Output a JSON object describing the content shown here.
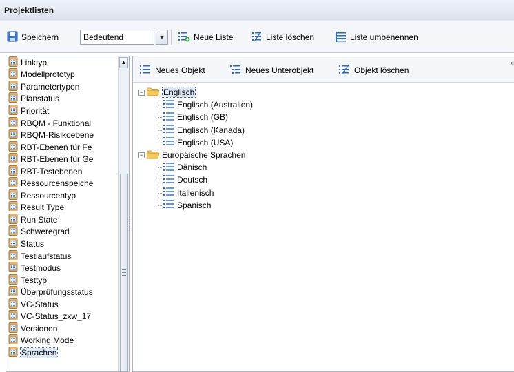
{
  "window": {
    "title": "Projektlisten"
  },
  "toolbar": {
    "save_label": "Speichern",
    "filter_value": "Bedeutend",
    "new_list_label": "Neue Liste",
    "delete_list_label": "Liste löschen",
    "rename_list_label": "Liste umbenennen"
  },
  "lists": {
    "items": [
      {
        "label": "Linktyp"
      },
      {
        "label": "Modellprototyp"
      },
      {
        "label": "Parametertypen"
      },
      {
        "label": "Planstatus"
      },
      {
        "label": "Priorität"
      },
      {
        "label": "RBQM - Funktional"
      },
      {
        "label": "RBQM-Risikoebene"
      },
      {
        "label": "RBT-Ebenen für Fe"
      },
      {
        "label": "RBT-Ebenen für Ge"
      },
      {
        "label": "RBT-Testebenen"
      },
      {
        "label": "Ressourcenspeiche"
      },
      {
        "label": "Ressourcentyp"
      },
      {
        "label": "Result Type"
      },
      {
        "label": "Run State"
      },
      {
        "label": "Schweregrad"
      },
      {
        "label": "Status"
      },
      {
        "label": "Testlaufstatus"
      },
      {
        "label": "Testmodus"
      },
      {
        "label": "Testtyp"
      },
      {
        "label": "Überprüfungsstatus"
      },
      {
        "label": "VC-Status"
      },
      {
        "label": "VC-Status_zxw_17"
      },
      {
        "label": "Versionen"
      },
      {
        "label": "Working Mode"
      },
      {
        "label": "Sprachen"
      }
    ],
    "selected": "Sprachen"
  },
  "objects_toolbar": {
    "new_object_label": "Neues Objekt",
    "new_subobject_label": "Neues Unterobjekt",
    "delete_object_label": "Objekt löschen"
  },
  "tree": {
    "groups": [
      {
        "label": "Englisch",
        "children": [
          "Englisch (Australien)",
          "Englisch (GB)",
          "Englisch (Kanada)",
          "Englisch (USA)"
        ]
      },
      {
        "label": "Europäische Sprachen",
        "children": [
          "Dänisch",
          "Deutsch",
          "Italienisch",
          "Spanisch"
        ]
      }
    ]
  },
  "icons": {
    "save": "save-icon",
    "dropdown": "chevron-down-icon",
    "new_list": "new-list-icon",
    "delete_list": "delete-list-icon",
    "rename_list": "rename-list-icon",
    "list_item": "list-table-icon",
    "folder": "folder-icon",
    "entry": "list-entry-icon"
  },
  "colors": {
    "titlebar_bg": "#dce3ee",
    "toolbar_bg": "#f4f6fa",
    "selection_bg": "#dde8f7",
    "icon_blue": "#2a6cc1",
    "folder_yellow": "#f2d27a"
  }
}
